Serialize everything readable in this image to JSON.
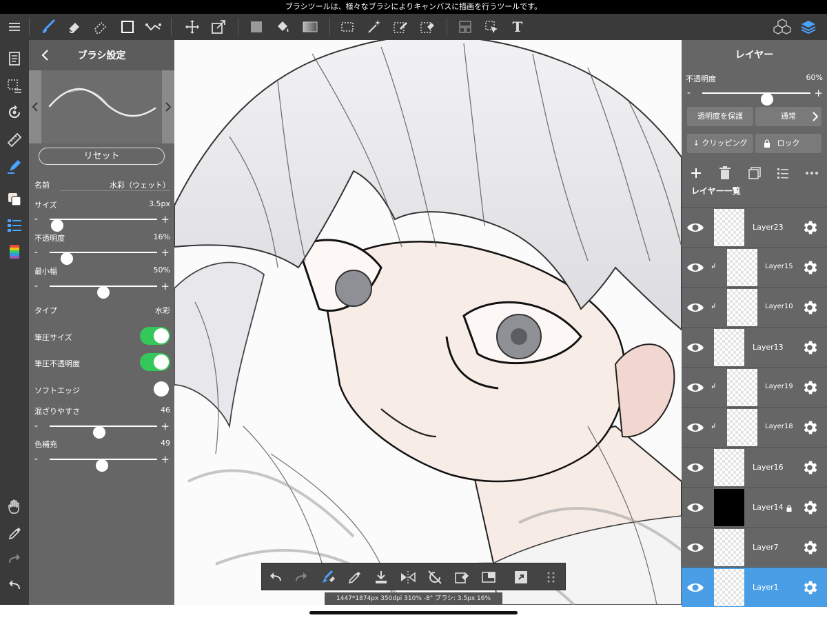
{
  "tooltip": "ブラシツールは、様々なブラシによりキャンバスに描画を行うツールです。",
  "colors": {
    "accent": "#4a9ee6",
    "toggle_on": "#34c759",
    "panel": "#666666",
    "toolbar": "#3a3a3a"
  },
  "toolbar": {
    "icons": [
      "menu-icon",
      "brush-icon",
      "eraser-icon",
      "blur-icon",
      "rectangle-icon",
      "magic-line-icon",
      "move-icon",
      "transform-icon",
      "fill-color-icon",
      "bucket-icon",
      "gradient-icon",
      "select-rect-icon",
      "magic-wand-icon",
      "select-pen-icon",
      "select-eraser-icon",
      "frame-icon",
      "operation-icon",
      "text-icon",
      "3d-material-icon",
      "layers-icon"
    ],
    "text_tool": "T"
  },
  "leftbar": {
    "icons": [
      "pages-icon",
      "selection-icon",
      "rotate-icon",
      "ruler-icon",
      "pen-blue-icon",
      "color-swatch-icon",
      "brush-list-icon",
      "color-picker-icon",
      "hand-icon",
      "eyedropper-icon",
      "redo-icon",
      "undo-icon"
    ]
  },
  "brush": {
    "title": "ブラシ設定",
    "reset": "リセット",
    "name_label": "名前",
    "name_value": "水彩（ウェット）",
    "size": {
      "label": "サイズ",
      "value": "3.5px",
      "level": 0.07
    },
    "opacity": {
      "label": "不透明度",
      "value": "16%",
      "level": 0.16
    },
    "min_width": {
      "label": "最小幅",
      "value": "50%",
      "level": 0.5
    },
    "type": {
      "label": "タイプ",
      "value": "水彩"
    },
    "pressure_size": {
      "label": "筆圧サイズ",
      "on": true
    },
    "pressure_opacity": {
      "label": "筆圧不透明度",
      "on": true
    },
    "soft_edge": {
      "label": "ソフトエッジ",
      "on": false
    },
    "mixing": {
      "label": "混ざりやすさ",
      "value": "46",
      "level": 0.46
    },
    "color_fill": {
      "label": "色補充",
      "value": "49",
      "level": 0.49
    },
    "minus": "-",
    "plus": "+"
  },
  "layers": {
    "title": "レイヤー",
    "opacity_label": "不透明度",
    "opacity_value": "60%",
    "opacity_level": 0.6,
    "protect_alpha": "透明度を保護",
    "blend_mode": "通常",
    "clipping": "クリッピング",
    "lock": "ロック",
    "list_title": "レイヤー一覧",
    "items": [
      {
        "name": "Layer23",
        "clip": false,
        "thumb": "transparent",
        "locked": false,
        "selected": false
      },
      {
        "name": "Layer15",
        "clip": true,
        "thumb": "transparent",
        "locked": false,
        "selected": false
      },
      {
        "name": "Layer10",
        "clip": true,
        "thumb": "transparent",
        "locked": false,
        "selected": false
      },
      {
        "name": "Layer13",
        "clip": false,
        "thumb": "transparent",
        "locked": false,
        "selected": false
      },
      {
        "name": "Layer19",
        "clip": true,
        "thumb": "transparent",
        "locked": false,
        "selected": false
      },
      {
        "name": "Layer18",
        "clip": true,
        "thumb": "transparent",
        "locked": false,
        "selected": false
      },
      {
        "name": "Layer16",
        "clip": false,
        "thumb": "transparent",
        "locked": false,
        "selected": false
      },
      {
        "name": "Layer14",
        "clip": false,
        "thumb": "black",
        "locked": true,
        "selected": false
      },
      {
        "name": "Layer7",
        "clip": false,
        "thumb": "transparent",
        "locked": false,
        "selected": false
      },
      {
        "name": "Layer1",
        "clip": false,
        "thumb": "transparent",
        "locked": false,
        "selected": true
      }
    ]
  },
  "bottombar": {
    "icons": [
      "undo-icon",
      "redo-icon",
      "brush-eraser-icon",
      "eyedropper-icon",
      "save-icon",
      "flip-icon",
      "rotate-reset-icon",
      "clear-icon",
      "window-icon",
      "snap-icon",
      "more-icon"
    ]
  },
  "status": "1447*1874px 350dpi 310% -8° ブラシ: 3.5px 16%"
}
